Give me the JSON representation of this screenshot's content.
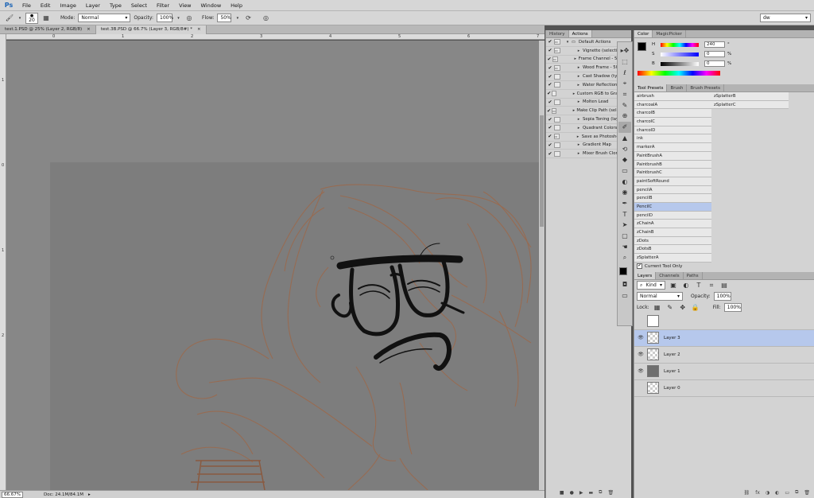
{
  "app": {
    "logo": "Ps"
  },
  "menu": [
    "File",
    "Edit",
    "Image",
    "Layer",
    "Type",
    "Select",
    "Filter",
    "View",
    "Window",
    "Help"
  ],
  "options": {
    "brush_size": "20",
    "mode_label": "Mode:",
    "mode_value": "Normal",
    "opacity_label": "Opacity:",
    "opacity_value": "100%",
    "flow_label": "Flow:",
    "flow_value": "50%",
    "workspace": "dw"
  },
  "doc_tabs": [
    {
      "label": "test.1.PSD @ 25% (Layer 2, RGB/8)",
      "close": "×"
    },
    {
      "label": "test.3B.PSD @ 66.7% (Layer 3, RGB/8#) *",
      "close": "×"
    }
  ],
  "rulers": {
    "top": [
      "0",
      "1",
      "2",
      "3",
      "4",
      "5",
      "6",
      "7"
    ],
    "left": [
      "1",
      "0",
      "1",
      "2"
    ]
  },
  "status": {
    "zoom": "66.67%",
    "doc": "Doc: 24.1M/84.1M"
  },
  "history_actions": {
    "tabs": [
      "History",
      "Actions"
    ],
    "rows": [
      {
        "label": "Default Actions",
        "check": "✔",
        "dialog": true,
        "tri": "▾"
      },
      {
        "label": "Vignette (selection)",
        "check": "✔",
        "dialog": true,
        "tri": "▸"
      },
      {
        "label": "Frame Channel - 50 pixel",
        "check": "✔",
        "dialog": true,
        "tri": "▸"
      },
      {
        "label": "Wood Frame - 50 pixel",
        "check": "✔",
        "dialog": true,
        "tri": "▸"
      },
      {
        "label": "Cast Shadow (type)",
        "check": "✔",
        "dialog": false,
        "tri": "▸"
      },
      {
        "label": "Water Reflection (type)",
        "check": "✔",
        "dialog": false,
        "tri": "▸"
      },
      {
        "label": "Custom RGB to Grayscale",
        "check": "✔",
        "dialog": false,
        "tri": "▸"
      },
      {
        "label": "Molten Lead",
        "check": "✔",
        "dialog": false,
        "tri": "▸"
      },
      {
        "label": "Make Clip Path (selection)",
        "check": "✔",
        "dialog": true,
        "tri": "▸"
      },
      {
        "label": "Sepia Toning (layer)",
        "check": "✔",
        "dialog": false,
        "tri": "▸"
      },
      {
        "label": "Quadrant Colors",
        "check": "✔",
        "dialog": false,
        "tri": "▸"
      },
      {
        "label": "Save as Photoshop PDF",
        "check": "✔",
        "dialog": true,
        "tri": "▸"
      },
      {
        "label": "Gradient Map",
        "check": "✔",
        "dialog": false,
        "tri": "▸"
      },
      {
        "label": "Mixer Brush Cloning",
        "check": "✔",
        "dialog": false,
        "tri": "▸"
      }
    ],
    "footer": [
      "■",
      "●",
      "▶",
      "▬",
      "⧉",
      "🗑"
    ]
  },
  "tools": [
    "▸✥",
    "⬚",
    "ℓ",
    "⌖",
    "⌗",
    "✎",
    "⊕",
    "✐",
    "▲",
    "⟲",
    "◆",
    "▭",
    "◐",
    "◉",
    "✒",
    "T",
    "➤",
    "▢",
    "☚",
    "⌕"
  ],
  "color": {
    "tabs": [
      "Color",
      "MagicPicker"
    ],
    "sliders": [
      {
        "label": "H",
        "value": "240",
        "unit": "°"
      },
      {
        "label": "S",
        "value": "0",
        "unit": "%"
      },
      {
        "label": "B",
        "value": "0",
        "unit": "%"
      }
    ],
    "fg": "#000000",
    "bg": "#ffffff"
  },
  "presets": {
    "tabs": [
      "Tool Presets",
      "Brush",
      "Brush Presets"
    ],
    "col1": [
      "airbrush",
      "charcoalA",
      "charcolB",
      "charcolC",
      "charcolD",
      "ink",
      "markerA",
      "PaintBrushA",
      "PaintbrushB",
      "PaintbrushC",
      "paintSoftRound",
      "pencilA",
      "pencilB",
      "PencilC",
      "pencilD",
      "zChainA",
      "zChainB",
      "zDots",
      "zDotsB",
      "zSplatterA"
    ],
    "col2": [
      "zSplatterB",
      "zSplatterC"
    ],
    "selected": "PencilC",
    "current_only": "Current Tool Only"
  },
  "layers": {
    "tabs": [
      "Layers",
      "Channels",
      "Paths"
    ],
    "kind": "Kind",
    "blend": "Normal",
    "opacity_label": "Opacity:",
    "opacity_value": "100%",
    "lock_label": "Lock:",
    "fill_label": "Fill:",
    "fill_value": "100%",
    "items": [
      {
        "name": "",
        "eye": "",
        "thumb": "white"
      },
      {
        "name": "Layer 3",
        "eye": "👁",
        "thumb": "check",
        "sel": true
      },
      {
        "name": "Layer 2",
        "eye": "👁",
        "thumb": "check"
      },
      {
        "name": "Layer 1",
        "eye": "👁",
        "thumb": "gray"
      },
      {
        "name": "Layer 0",
        "eye": "",
        "thumb": "check"
      }
    ],
    "footer": [
      "⛓",
      "fx",
      "◑",
      "◐",
      "▭",
      "⧉",
      "🗑"
    ]
  }
}
